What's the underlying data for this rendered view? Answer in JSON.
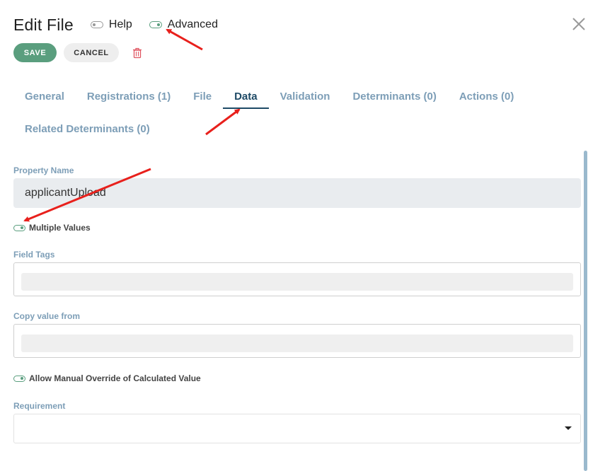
{
  "header": {
    "title": "Edit File",
    "help_label": "Help",
    "help_on": false,
    "advanced_label": "Advanced",
    "advanced_on": true
  },
  "actions": {
    "save_label": "SAVE",
    "cancel_label": "CANCEL"
  },
  "tabs": {
    "row1": [
      "General",
      "Registrations (1)",
      "File",
      "Data",
      "Validation",
      "Determinants (0)",
      "Actions (0)"
    ],
    "row2": [
      "Related Determinants (0)"
    ],
    "active": "Data"
  },
  "form": {
    "property_name_label": "Property Name",
    "property_name_value": "applicantUpload",
    "multiple_values_label": "Multiple Values",
    "field_tags_label": "Field Tags",
    "copy_value_label": "Copy value from",
    "manual_override_label": "Allow Manual Override of Calculated Value",
    "requirement_label": "Requirement",
    "requirement_value": ""
  },
  "colors": {
    "accent_green": "#5a9e7e",
    "tab_inactive": "#7d9eb7",
    "tab_active": "#1e4a66",
    "annotation_red": "#e8201c"
  }
}
